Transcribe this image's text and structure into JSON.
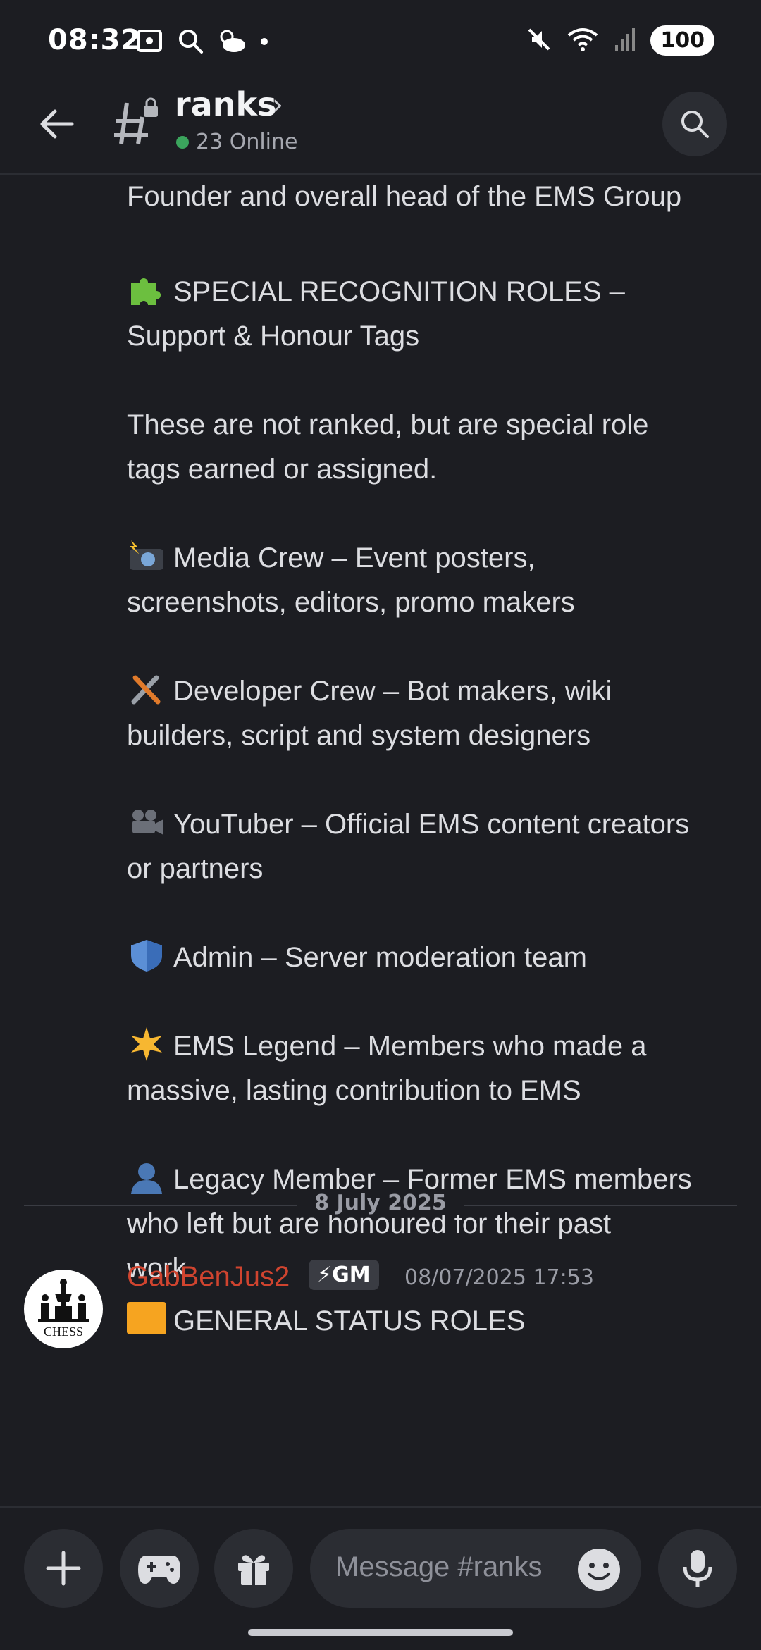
{
  "status_bar": {
    "time": "08:32",
    "battery": "100",
    "left_icons": [
      "screen-capture-icon",
      "search-icon",
      "weather-icon",
      "dot-icon"
    ],
    "right_icons": [
      "mute-icon",
      "wifi-icon",
      "signal-icon"
    ]
  },
  "header": {
    "channel": "ranks",
    "online": "23 Online"
  },
  "message": {
    "lines": {
      "founder": "Founder and overall head of the EMS Group",
      "special_1": "SPECIAL RECOGNITION ROLES –",
      "special_2": "Support & Honour Tags",
      "note_1": "These are not ranked, but are special role",
      "note_2": "tags earned or assigned.",
      "media_1": "Media Crew – Event posters,",
      "media_2": "screenshots, editors, promo makers",
      "dev_1": "Developer Crew – Bot makers, wiki",
      "dev_2": "builders, script and system designers",
      "yt_1": "YouTuber – Official EMS content creators",
      "yt_2": "or partners",
      "admin": "Admin – Server moderation team",
      "legend_1": "EMS Legend – Members who made a",
      "legend_2": "massive, lasting contribution to EMS",
      "legacy_1": "Legacy Member – Former EMS members",
      "legacy_2": "who left but are honoured for their past",
      "legacy_3": "work"
    },
    "emoji_names": [
      "puzzle-emoji",
      "camera-flash-emoji",
      "tools-emoji",
      "movie-camera-emoji",
      "shield-emoji",
      "star-emoji",
      "silhouette-emoji"
    ]
  },
  "date_divider": "8 July 2025",
  "next_message": {
    "avatar_text": "CHESS",
    "username": "GabBenJus2",
    "badge": "⚡GM",
    "timestamp": "08/07/2025 17:53",
    "first_line": "GENERAL STATUS ROLES"
  },
  "composer": {
    "placeholder": "Message #ranks"
  },
  "colors": {
    "background": "#1c1d22",
    "username": "#d0442f",
    "online_dot": "#3ba55d",
    "surface": "#2b2d33"
  }
}
